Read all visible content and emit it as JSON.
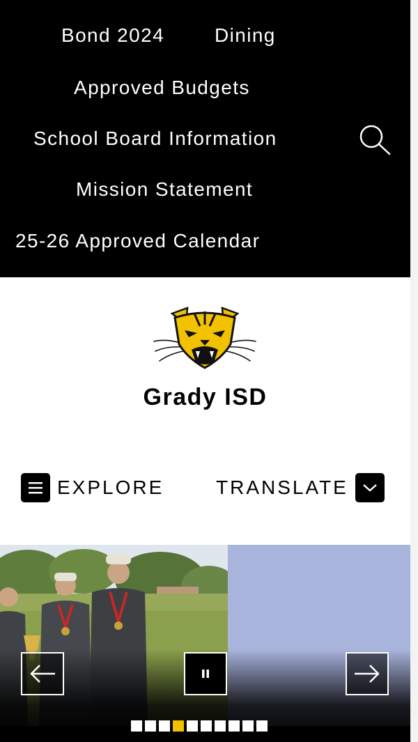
{
  "nav": {
    "links": [
      {
        "label": "Bond 2024"
      },
      {
        "label": "Dining"
      },
      {
        "label": "Approved Budgets"
      },
      {
        "label": "School Board Information"
      },
      {
        "label": "Mission Statement"
      },
      {
        "label": "25-26 Approved Calendar"
      }
    ],
    "search_icon": "search-icon"
  },
  "branding": {
    "logo_icon": "wildcat-logo",
    "title": "Grady ISD"
  },
  "menu": {
    "explore_label": "EXPLORE",
    "explore_icon": "hamburger-icon",
    "translate_label": "TRANSLATE",
    "translate_icon": "chevron-down-icon"
  },
  "slideshow": {
    "prev_icon": "arrow-left-icon",
    "pause_icon": "pause-icon",
    "next_icon": "arrow-right-icon",
    "slide_count": 10,
    "active_slide": 4
  },
  "colors": {
    "nav_background": "#000000",
    "accent_gold": "#f2c200",
    "panel_blue": "#a9b4dd"
  }
}
